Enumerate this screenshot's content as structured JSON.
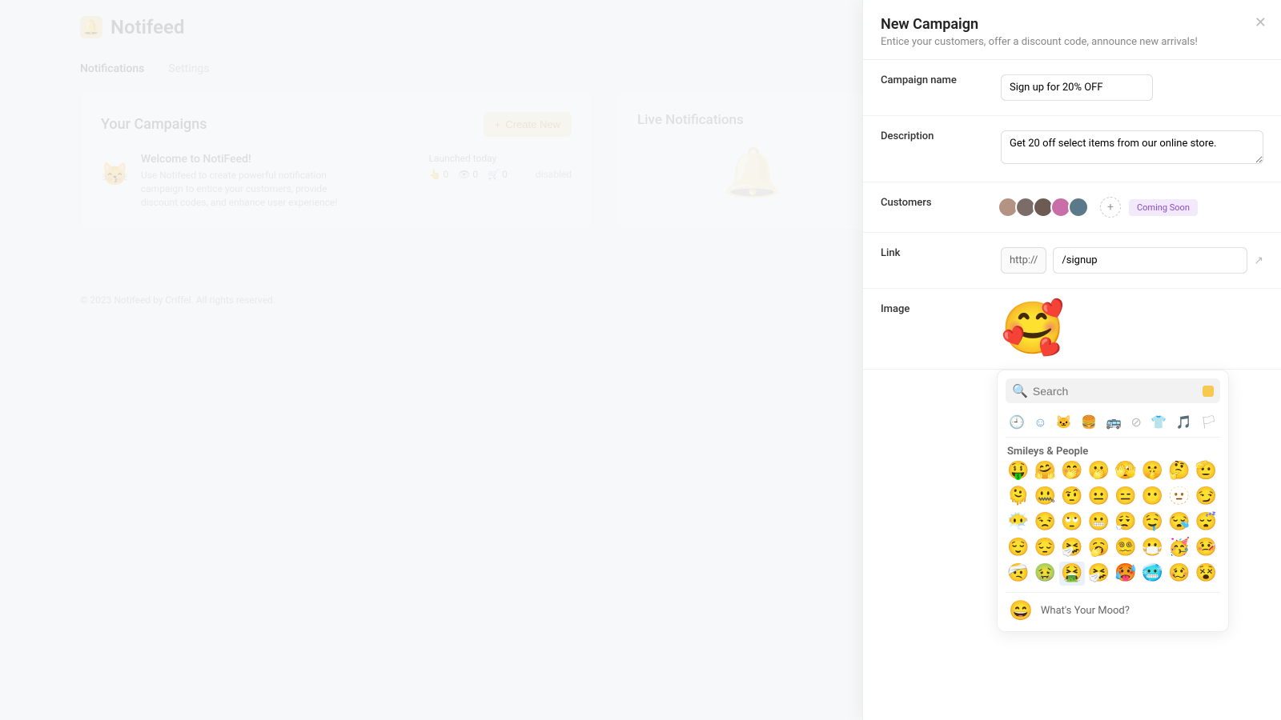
{
  "brand": {
    "name": "Notifeed",
    "icon": "🔔"
  },
  "tabs": {
    "notifications": "Notifications",
    "settings": "Settings"
  },
  "campaigns": {
    "title": "Your Campaigns",
    "create_label": "Create New",
    "item": {
      "emoji": "😽",
      "title": "Welcome to NotiFeed!",
      "desc": "Use Notifeed to create powerful notification campaign to entice your customers, provide discount codes, and enhance user experience!",
      "launched": "Launched today",
      "clicks": "0",
      "views": "0",
      "carts": "0",
      "status": "disabled"
    }
  },
  "live": {
    "title": "Live Notifications",
    "icon": "🔔"
  },
  "footer_text": "© 2023 Notifeed by Criffel. All rights reserved.",
  "drawer": {
    "title": "New Campaign",
    "subtitle": "Entice your customers, offer a discount code, announce new arrivals!",
    "labels": {
      "campaign_name": "Campaign name",
      "description": "Description",
      "customers": "Customers",
      "link": "Link",
      "image": "Image"
    },
    "campaign_name_value": "Sign up for 20% OFF",
    "description_value": "Get 20 off select items from our online store.",
    "customers_badge": "Coming Soon",
    "link_prefix": "http://",
    "link_value": "/signup",
    "selected_emoji": "🥰"
  },
  "picker": {
    "search_placeholder": "Search",
    "section_title": "Smileys & People",
    "footer_emoji": "😄",
    "footer_text": "What's Your Mood?",
    "cats": [
      "🕘",
      "☺",
      "🐱",
      "🍔",
      "🚌",
      "⊘",
      "👕",
      "🎵",
      "🏳"
    ],
    "emojis": [
      "🤑",
      "🤗",
      "🤭",
      "🫢",
      "🫣",
      "🤫",
      "🤔",
      "🫡",
      "🫠",
      "🤐",
      "🤨",
      "😐",
      "😑",
      "😶",
      "🫥",
      "😏",
      "😶‍🌫️",
      "😒",
      "🙄",
      "😬",
      "😮‍💨",
      "🤤",
      "😪",
      "😴",
      "😌",
      "😔",
      "🤧",
      "🥱",
      "😵‍💫",
      "😷",
      "🥳",
      "🤒",
      "🤕",
      "🤢",
      "🤮",
      "🤧",
      "🥵",
      "🥶",
      "🥴",
      "😵"
    ],
    "selected_index": 34
  },
  "avatar_colors": [
    "#b49284",
    "#7c6c68",
    "#6d5a52",
    "#c86fa8",
    "#5a7a8a"
  ]
}
